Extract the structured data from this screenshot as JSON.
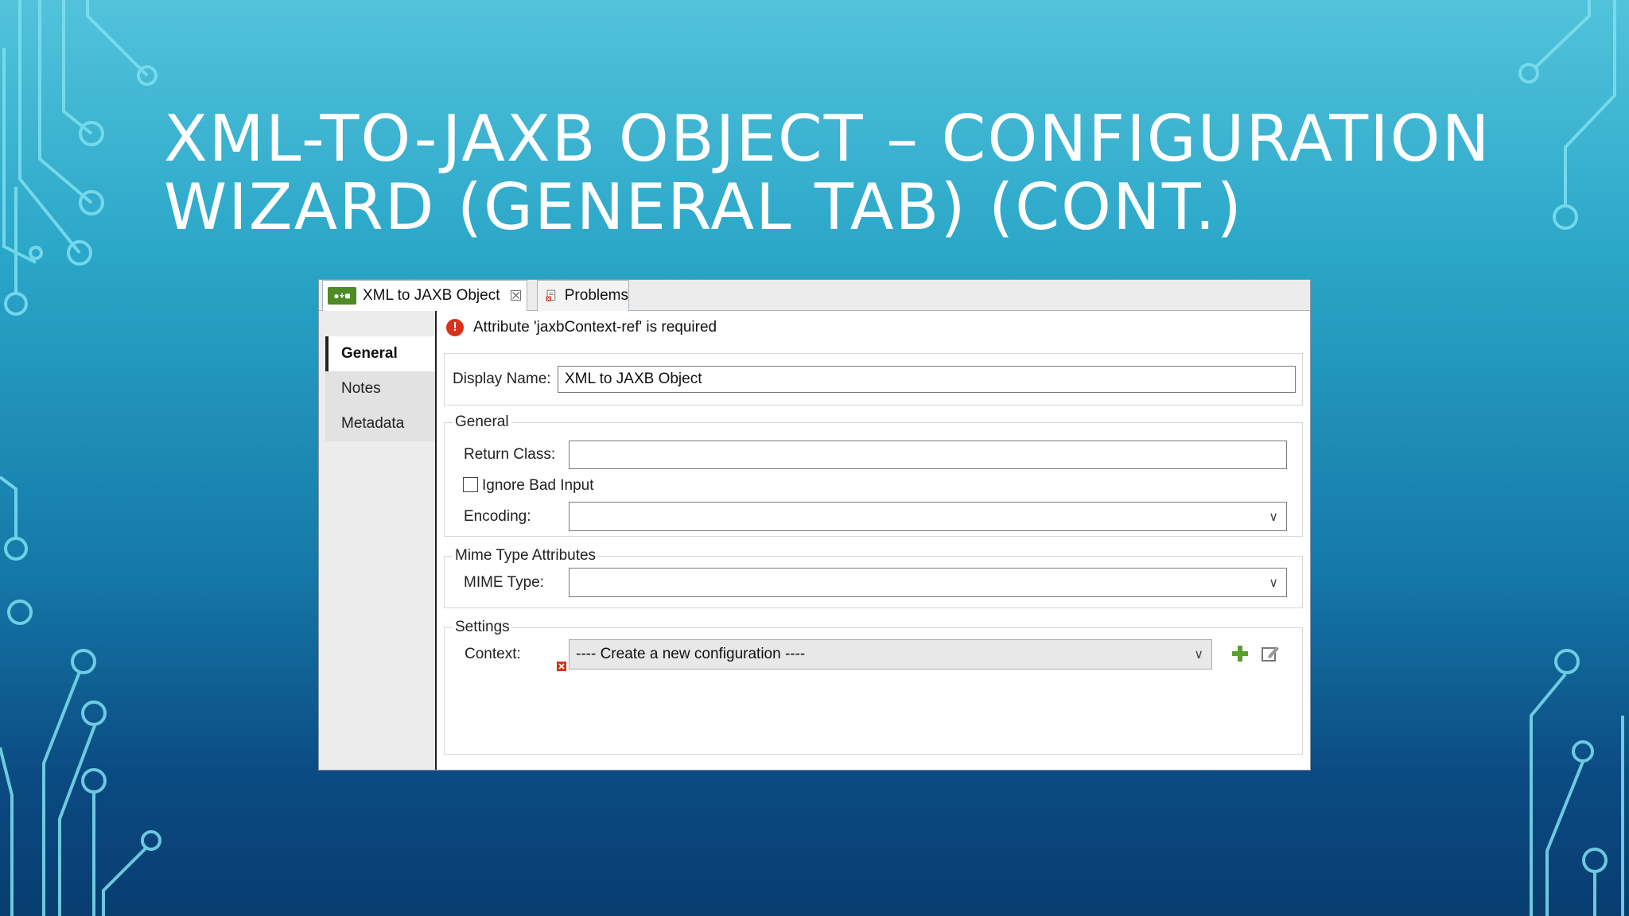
{
  "slide": {
    "title_line1": "XML-TO-JAXB OBJECT – CONFIGURATION",
    "title_line2": "WIZARD (GENERAL TAB) (CONT.)"
  },
  "window": {
    "tabs": [
      {
        "label": "XML to JAXB Object",
        "icon": "app-icon",
        "close": "☒"
      },
      {
        "label": "Problems",
        "icon": "problems-icon"
      }
    ],
    "sidebar": {
      "items": [
        {
          "label": "General",
          "active": true
        },
        {
          "label": "Notes"
        },
        {
          "label": "Metadata"
        }
      ]
    },
    "error_message": "Attribute 'jaxbContext-ref' is required",
    "display_name": {
      "label": "Display Name:",
      "value": "XML to JAXB Object"
    },
    "general_group": {
      "legend": "General",
      "return_class_label": "Return Class:",
      "return_class_value": "",
      "ignore_bad_input_label": "Ignore Bad Input",
      "ignore_bad_input_checked": false,
      "encoding_label": "Encoding:",
      "encoding_value": ""
    },
    "mime_group": {
      "legend": "Mime Type Attributes",
      "mime_label": "MIME Type:",
      "mime_value": ""
    },
    "settings_group": {
      "legend": "Settings",
      "context_label": "Context:",
      "context_value": "---- Create a new configuration ----"
    }
  },
  "colors": {
    "error": "#d9311b",
    "add_icon": "#5aa02c",
    "app_icon": "#4e8a25"
  }
}
